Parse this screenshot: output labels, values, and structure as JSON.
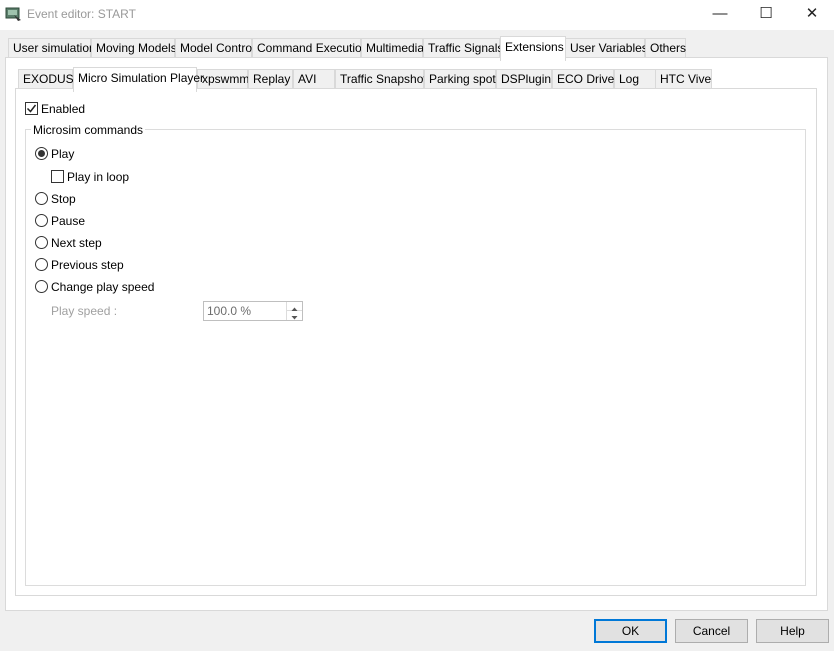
{
  "window": {
    "title": "Event editor: START",
    "minimize_glyph": "—",
    "maximize_glyph": "☐",
    "close_glyph": "✕"
  },
  "main_tabs": [
    {
      "label": "User simulation"
    },
    {
      "label": "Moving Models"
    },
    {
      "label": "Model Control"
    },
    {
      "label": "Command Execution"
    },
    {
      "label": "Multimedia"
    },
    {
      "label": "Traffic Signals"
    },
    {
      "label": "Extensions",
      "active": true
    },
    {
      "label": "User Variables"
    },
    {
      "label": "Others"
    }
  ],
  "sub_tabs": [
    {
      "label": "EXODUS"
    },
    {
      "label": "Micro Simulation Player",
      "active": true
    },
    {
      "label": "xpswmm"
    },
    {
      "label": "Replay"
    },
    {
      "label": "AVI"
    },
    {
      "label": "Traffic Snapshot"
    },
    {
      "label": "Parking spot"
    },
    {
      "label": "DSPlugin"
    },
    {
      "label": "ECO Drive"
    },
    {
      "label": "Log"
    },
    {
      "label": "HTC Vive"
    }
  ],
  "enabled": {
    "label": "Enabled",
    "checked": true
  },
  "group": {
    "title": "Microsim commands",
    "options": [
      {
        "label": "Play",
        "selected": true
      },
      {
        "label": "Stop",
        "selected": false
      },
      {
        "label": "Pause",
        "selected": false
      },
      {
        "label": "Next step",
        "selected": false
      },
      {
        "label": "Previous step",
        "selected": false
      },
      {
        "label": "Change play speed",
        "selected": false
      }
    ],
    "play_in_loop": {
      "label": "Play in loop",
      "checked": false
    },
    "play_speed": {
      "label": "Play speed :",
      "value": "100.0 %"
    }
  },
  "buttons": {
    "ok": "OK",
    "cancel": "Cancel",
    "help": "Help"
  },
  "colors": {
    "accent": "#0078d7",
    "disabled_text": "#a0a0a0"
  }
}
